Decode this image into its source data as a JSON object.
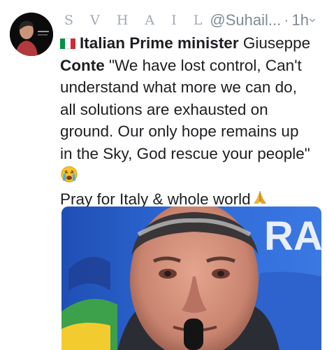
{
  "tweet": {
    "author": {
      "display_name": "S V H A I L",
      "handle": "@Suhail...",
      "avatar_icon": "user-avatar-icon"
    },
    "separator": "·",
    "timestamp": "1h",
    "menu_icon": "chevron-down-icon",
    "lines": [
      {
        "flag_icon": "italy-flag-icon",
        "bold": "Italian Prime minister",
        "rest": " Giuseppe"
      },
      {
        "bold": "Conte",
        "rest": " \"We have lost control, Can't"
      },
      {
        "text": "understand what more we can do,"
      },
      {
        "text": "all solutions are exhausted on"
      },
      {
        "text": "ground. Our only hope remains up"
      },
      {
        "text": "in the Sky, God rescue your people\""
      }
    ],
    "crying_emoji_icon": "crying-face-icon",
    "pray_line": "Pray for Italy & whole world",
    "pray_icon": "folded-hands-icon",
    "media": {
      "description_icon": "photo-icon",
      "banner_text": "RA"
    },
    "colors": {
      "text": "#1c1e21",
      "meta": "#7f8b95",
      "italy_green": "#009246",
      "italy_white": "#ffffff",
      "italy_red": "#ce2b37"
    }
  }
}
